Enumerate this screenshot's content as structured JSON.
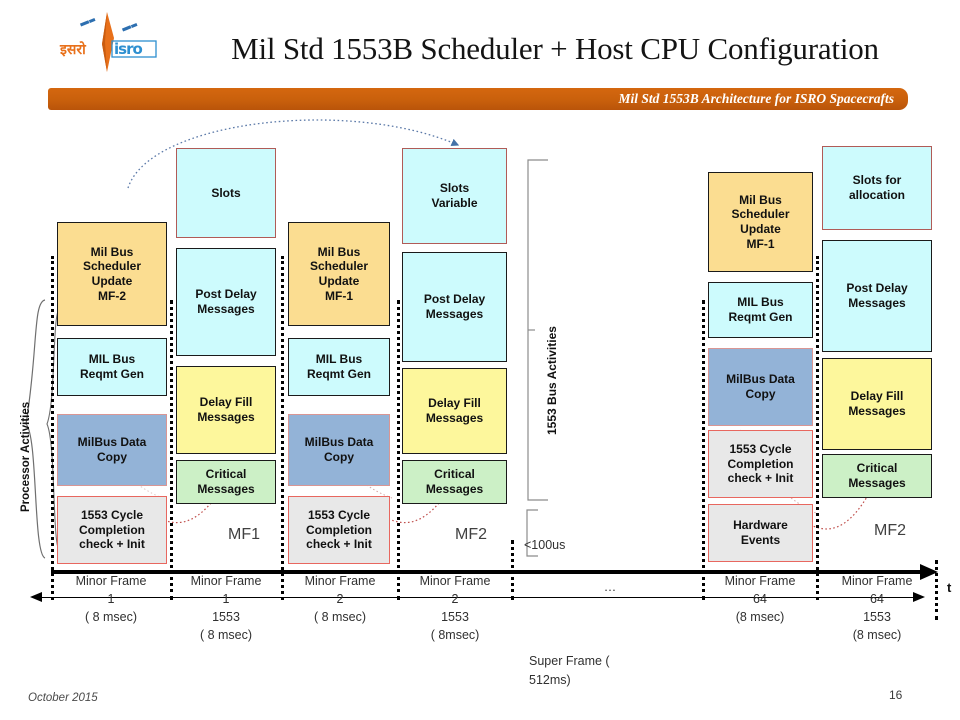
{
  "header": {
    "logo_alt": "isro-logo",
    "logo_text_hindi": "इसरो",
    "logo_text_latin": "isro",
    "title": "Mil Std 1553B Scheduler + Host CPU Configuration",
    "banner": "Mil Std 1553B Architecture for ISRO Spacecrafts",
    "banner_color": "#c9600c"
  },
  "axis_labels": {
    "processor_activities": "Processor  Activities",
    "bus_activities": "1553 Bus  Activities",
    "gap_note": "<100us",
    "time_axis": "t",
    "super_frame": "Super  Frame (\n512ms)",
    "ellipsis": "…"
  },
  "colors": {
    "orange": "#fbdd91",
    "cyan": "#cdfbfd",
    "blue": "#93b3d7",
    "grey": "#e8e8e8",
    "yellow": "#fdf79c",
    "green": "#ccf0c6",
    "arrow_red": "#c0504d",
    "arrow_blue": "#4472a8"
  },
  "columns": [
    {
      "id": "proc-mf1",
      "kind": "processor",
      "tag": "",
      "boxes": [
        {
          "label": "Mil Bus\nScheduler\nUpdate\nMF-2",
          "style": "b-orange"
        },
        {
          "label": "MIL Bus\nReqmt Gen",
          "style": "b-cyan"
        },
        {
          "label": "MilBus Data\nCopy",
          "style": "b-blue"
        },
        {
          "label": "1553 Cycle\nCompletion\ncheck + Init",
          "style": "b-grey"
        }
      ]
    },
    {
      "id": "bus-mf1",
      "kind": "bus",
      "tag": "MF1",
      "boxes": [
        {
          "label": "Slots",
          "style": "b-cyan-r"
        },
        {
          "label": "Post Delay\nMessages",
          "style": "b-cyan"
        },
        {
          "label": "Delay Fill\nMessages",
          "style": "b-yellow"
        },
        {
          "label": "Critical\nMessages",
          "style": "b-green"
        }
      ]
    },
    {
      "id": "proc-mf2",
      "kind": "processor",
      "tag": "",
      "boxes": [
        {
          "label": "Mil Bus\nScheduler\nUpdate\nMF-1",
          "style": "b-orange"
        },
        {
          "label": "MIL Bus\nReqmt Gen",
          "style": "b-cyan"
        },
        {
          "label": "MilBus Data\nCopy",
          "style": "b-blue"
        },
        {
          "label": "1553 Cycle\nCompletion\ncheck + Init",
          "style": "b-grey"
        }
      ]
    },
    {
      "id": "bus-mf2",
      "kind": "bus",
      "tag": "MF2",
      "boxes": [
        {
          "label": "Slots\nVariable",
          "style": "b-cyan-r"
        },
        {
          "label": "Post Delay\nMessages",
          "style": "b-cyan"
        },
        {
          "label": "Delay Fill\nMessages",
          "style": "b-yellow"
        },
        {
          "label": "Critical\nMessages",
          "style": "b-green"
        }
      ]
    },
    {
      "id": "proc-mf64",
      "kind": "processor",
      "tag": "",
      "boxes": [
        {
          "label": "Mil Bus\nScheduler\nUpdate\nMF-1",
          "style": "b-orange"
        },
        {
          "label": "MIL Bus\nReqmt Gen",
          "style": "b-cyan"
        },
        {
          "label": "MilBus Data\nCopy",
          "style": "b-blue"
        },
        {
          "label": "1553 Cycle\nCompletion\ncheck + Init",
          "style": "b-grey"
        },
        {
          "label": "Hardware\nEvents",
          "style": "b-grey"
        }
      ]
    },
    {
      "id": "bus-mf64",
      "kind": "bus",
      "tag": "MF2",
      "boxes": [
        {
          "label": "Slots for\nallocation",
          "style": "b-cyan-r"
        },
        {
          "label": "Post Delay\nMessages",
          "style": "b-cyan"
        },
        {
          "label": "Delay Fill\nMessages",
          "style": "b-yellow"
        },
        {
          "label": "Critical\nMessages",
          "style": "b-green"
        }
      ]
    }
  ],
  "timeline": [
    {
      "label": "Minor Frame\n1",
      "sub": "( 8 msec)"
    },
    {
      "label": "Minor Frame\n1",
      "sub": "1553\n(  8 msec)"
    },
    {
      "label": "Minor Frame\n2",
      "sub": "( 8 msec)"
    },
    {
      "label": "Minor Frame\n2",
      "sub": "1553\n( 8msec)"
    },
    {
      "label": "Minor Frame\n64",
      "sub": "(8 msec)"
    },
    {
      "label": "Minor Frame\n64",
      "sub": "1553\n(8 msec)"
    }
  ],
  "footer": {
    "date": "October 2015",
    "page": "16"
  }
}
